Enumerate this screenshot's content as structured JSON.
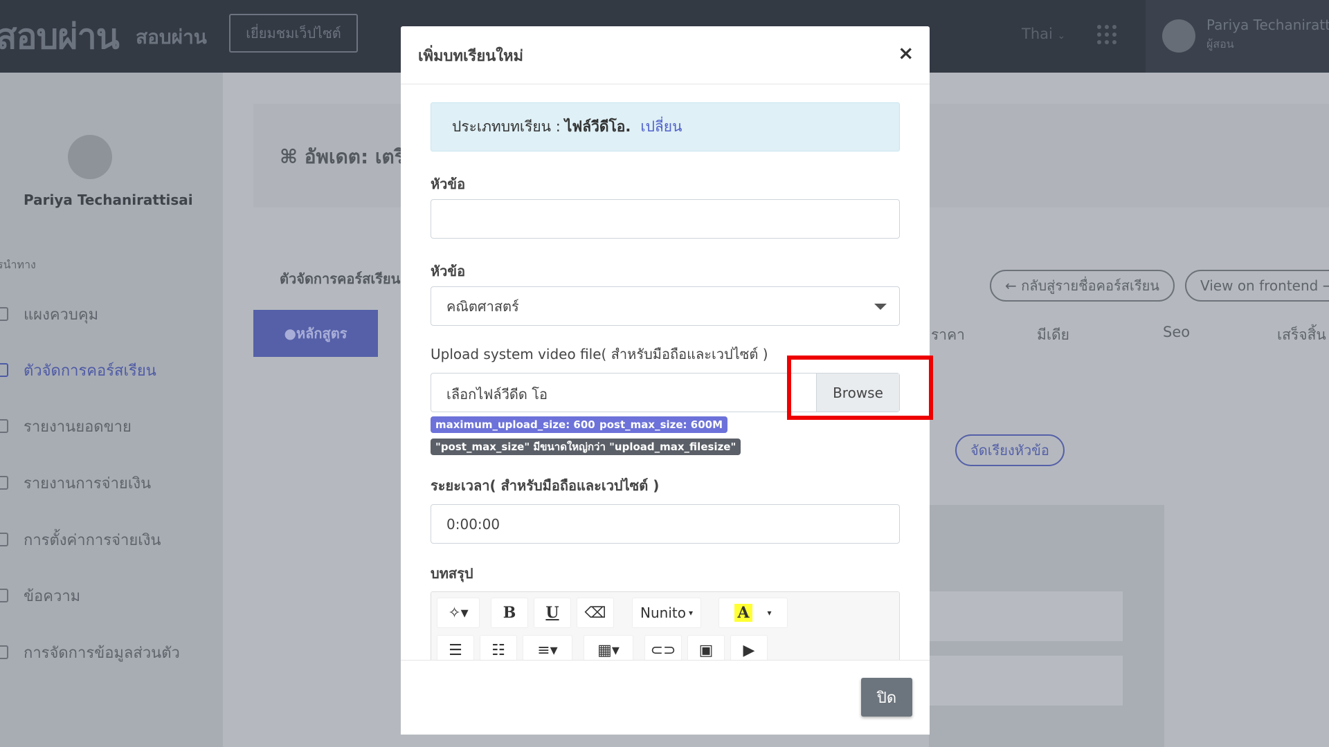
{
  "topbar": {
    "logo": "สอบผ่าน",
    "logo_sub": "สอบผ่าน",
    "visit_site": "เยี่ยมชมเว็ปไซต์",
    "language": "Thai",
    "user_name": "Pariya Techanirattisai",
    "user_role": "ผู้สอน"
  },
  "sidebar": {
    "profile_name": "Pariya Techanirattisai",
    "section_label": "รนำทาง",
    "items": [
      {
        "label": "แผงควบคุม"
      },
      {
        "label": "ตัวจัดการคอร์สเรียน"
      },
      {
        "label": "รายงานยอดขาย"
      },
      {
        "label": "รายงานการจ่ายเงิน"
      },
      {
        "label": "การตั้งค่าการจ่ายเงิน"
      },
      {
        "label": "ข้อความ"
      },
      {
        "label": "การจัดการข้อมูลส่วนตัว"
      }
    ]
  },
  "content": {
    "title": "อัพเดต: เตรี",
    "course_manager_label": "ตัวจัดการคอร์สเรียน",
    "back_button": "← กลับสู่รายชื่อคอร์สเรียน",
    "view_frontend": "View on frontend →",
    "tabs": {
      "course": "หลักสูตร",
      "price": "ราคา",
      "media": "มีเดีย",
      "seo": "Seo",
      "finish": "เสร็จสิ้น"
    },
    "sort_button": "จัดเรียงหัวข้อ"
  },
  "modal": {
    "title": "เพิ่มบทเรียนใหม่",
    "lesson_type_label": "ประเภทบทเรียน :",
    "lesson_type_value": "ไฟล์วีดีโอ.",
    "change_link": "เปลี่ยน",
    "title_label": "หัวข้อ",
    "title_value": "",
    "section_label": "หัวข้อ",
    "section_selected": "คณิตศาสตร์",
    "upload_label": "Upload system video file( สำหรับมือถือและเวปไซต์ )",
    "file_placeholder": "เลือกไฟล์วีดีด โอ",
    "browse_label": "Browse",
    "badges": {
      "max_upload": "maximum_upload_size: 600M",
      "post_max": "post_max_size: 600M",
      "warning": "\"post_max_size\" มีขนาดใหญ่กว่า \"upload_max_filesize\""
    },
    "duration_label": "ระยะเวลา( สำหรับมือถือและเวปไซต์ )",
    "duration_value": "0:00:00",
    "summary_label": "บทสรุป",
    "editor_toolbar": {
      "font_name": "Nunito",
      "bold": "B",
      "underline": "U",
      "color_letter": "A"
    },
    "close_button": "ปิด"
  }
}
